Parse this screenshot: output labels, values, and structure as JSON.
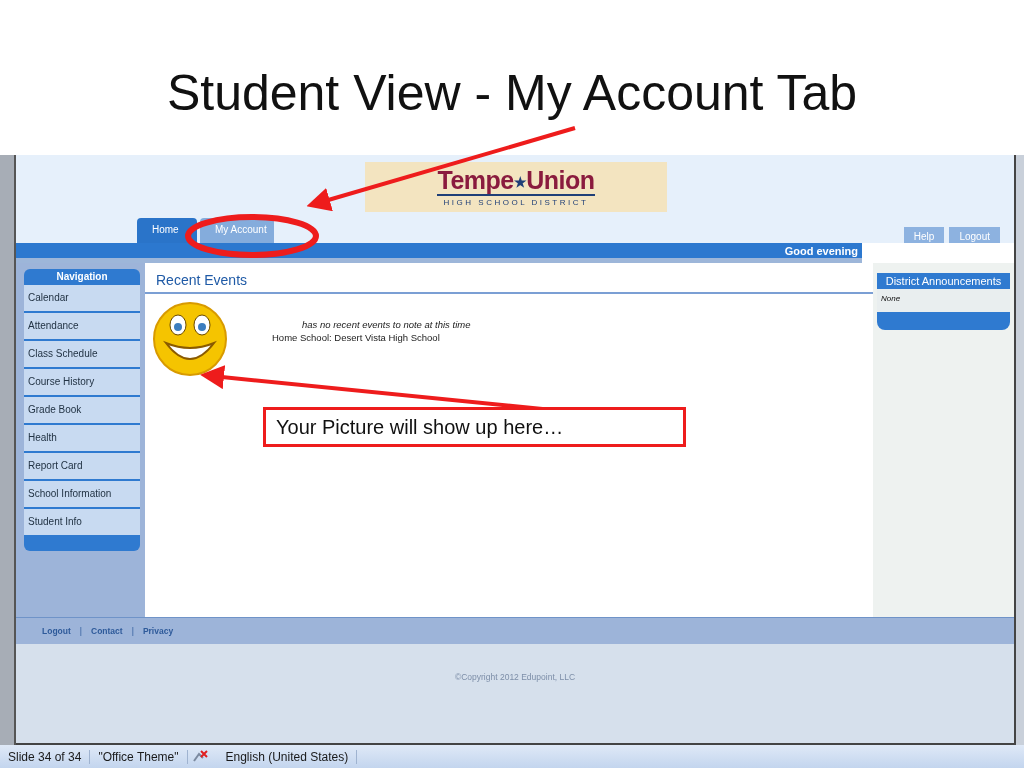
{
  "slide": {
    "title": "Student View - My Account Tab",
    "callout": "Your Picture will show up here…"
  },
  "header": {
    "logo": {
      "word_1": "Tempe",
      "star": "★",
      "word_2": "Union",
      "tagline": "HIGH SCHOOL DISTRICT"
    },
    "tabs": [
      {
        "label": "Home",
        "selected": true
      },
      {
        "label": "My Account",
        "selected": false
      }
    ],
    "buttons": [
      "Help",
      "Logout"
    ],
    "greeting": "Good evening"
  },
  "navigation": {
    "title": "Navigation",
    "items": [
      "Calendar",
      "Attendance",
      "Class Schedule",
      "Course History",
      "Grade Book",
      "Health",
      "Report Card",
      "School Information",
      "Student Info"
    ]
  },
  "content": {
    "title": "Recent Events",
    "message": "has no recent events to note at this time",
    "home_school": "Home School: Desert Vista High School"
  },
  "announcements": {
    "title": "District Announcements",
    "body": "None"
  },
  "footer": {
    "links": [
      "Logout",
      "Contact",
      "Privacy"
    ],
    "separator": "|",
    "copyright": "©Copyright 2012 Edupoint, LLC"
  },
  "status_bar": {
    "slide": "Slide 34 of 34",
    "theme": "\"Office Theme\"",
    "language": "English (United States)"
  }
}
